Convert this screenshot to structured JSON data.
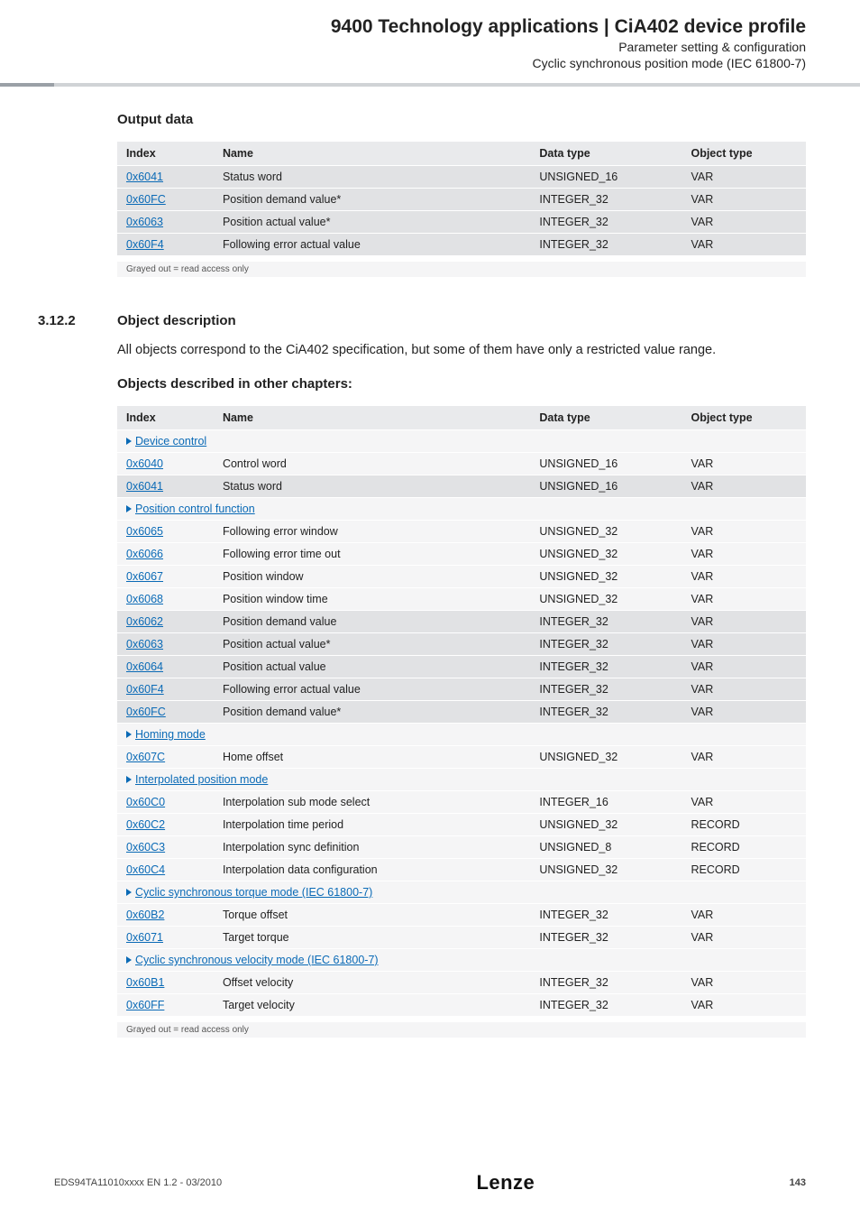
{
  "header": {
    "title": "9400 Technology applications | CiA402 device profile",
    "sub1": "Parameter setting & configuration",
    "sub2": "Cyclic synchronous position mode (IEC 61800-7)"
  },
  "output": {
    "heading": "Output data",
    "cols": [
      "Index",
      "Name",
      "Data type",
      "Object type"
    ],
    "rows": [
      {
        "idx": "0x6041",
        "name": "Status word",
        "dt": "UNSIGNED_16",
        "ot": "VAR",
        "shade": "dark"
      },
      {
        "idx": "0x60FC",
        "name": "Position demand value*",
        "dt": "INTEGER_32",
        "ot": "VAR",
        "shade": "dark"
      },
      {
        "idx": "0x6063",
        "name": "Position actual value*",
        "dt": "INTEGER_32",
        "ot": "VAR",
        "shade": "dark"
      },
      {
        "idx": "0x60F4",
        "name": "Following error actual value",
        "dt": "INTEGER_32",
        "ot": "VAR",
        "shade": "dark"
      }
    ],
    "footnote": "Grayed out = read access only"
  },
  "section": {
    "num": "3.12.2",
    "title": "Object description",
    "para": "All objects correspond to the CiA402 specification, but some of them have only a restricted value range."
  },
  "objects": {
    "heading": "Objects described in other chapters:",
    "cols": [
      "Index",
      "Name",
      "Data type",
      "Object type"
    ],
    "groups": [
      {
        "label": "Device control",
        "rows": [
          {
            "idx": "0x6040",
            "name": "Control word",
            "dt": "UNSIGNED_16",
            "ot": "VAR",
            "shade": "light"
          },
          {
            "idx": "0x6041",
            "name": "Status word",
            "dt": "UNSIGNED_16",
            "ot": "VAR",
            "shade": "dark"
          }
        ]
      },
      {
        "label": "Position control function",
        "rows": [
          {
            "idx": "0x6065",
            "name": "Following error window",
            "dt": "UNSIGNED_32",
            "ot": "VAR",
            "shade": "light"
          },
          {
            "idx": "0x6066",
            "name": "Following error time out",
            "dt": "UNSIGNED_32",
            "ot": "VAR",
            "shade": "light"
          },
          {
            "idx": "0x6067",
            "name": "Position window",
            "dt": "UNSIGNED_32",
            "ot": "VAR",
            "shade": "light"
          },
          {
            "idx": "0x6068",
            "name": "Position window time",
            "dt": "UNSIGNED_32",
            "ot": "VAR",
            "shade": "light"
          },
          {
            "idx": "0x6062",
            "name": "Position demand value",
            "dt": "INTEGER_32",
            "ot": "VAR",
            "shade": "dark"
          },
          {
            "idx": "0x6063",
            "name": "Position actual value*",
            "dt": "INTEGER_32",
            "ot": "VAR",
            "shade": "dark"
          },
          {
            "idx": "0x6064",
            "name": "Position actual value",
            "dt": "INTEGER_32",
            "ot": "VAR",
            "shade": "dark"
          },
          {
            "idx": "0x60F4",
            "name": "Following error actual value",
            "dt": "INTEGER_32",
            "ot": "VAR",
            "shade": "dark"
          },
          {
            "idx": "0x60FC",
            "name": "Position demand value*",
            "dt": "INTEGER_32",
            "ot": "VAR",
            "shade": "dark"
          }
        ]
      },
      {
        "label": "Homing mode",
        "rows": [
          {
            "idx": "0x607C",
            "name": "Home offset",
            "dt": "UNSIGNED_32",
            "ot": "VAR",
            "shade": "light"
          }
        ]
      },
      {
        "label": "Interpolated position mode",
        "rows": [
          {
            "idx": "0x60C0",
            "name": "Interpolation sub mode select",
            "dt": "INTEGER_16",
            "ot": "VAR",
            "shade": "light"
          },
          {
            "idx": "0x60C2",
            "name": "Interpolation time period",
            "dt": "UNSIGNED_32",
            "ot": "RECORD",
            "shade": "light"
          },
          {
            "idx": "0x60C3",
            "name": "Interpolation sync definition",
            "dt": "UNSIGNED_8",
            "ot": "RECORD",
            "shade": "light"
          },
          {
            "idx": "0x60C4",
            "name": "Interpolation data configuration",
            "dt": "UNSIGNED_32",
            "ot": "RECORD",
            "shade": "light"
          }
        ]
      },
      {
        "label": "Cyclic synchronous torque mode (IEC 61800-7)",
        "rows": [
          {
            "idx": "0x60B2",
            "name": "Torque offset",
            "dt": "INTEGER_32",
            "ot": "VAR",
            "shade": "light"
          },
          {
            "idx": "0x6071",
            "name": "Target torque",
            "dt": "INTEGER_32",
            "ot": "VAR",
            "shade": "light"
          }
        ]
      },
      {
        "label": "Cyclic synchronous velocity mode (IEC 61800-7)",
        "rows": [
          {
            "idx": "0x60B1",
            "name": "Offset velocity",
            "dt": "INTEGER_32",
            "ot": "VAR",
            "shade": "light"
          },
          {
            "idx": "0x60FF",
            "name": "Target velocity",
            "dt": "INTEGER_32",
            "ot": "VAR",
            "shade": "light"
          }
        ]
      }
    ],
    "footnote": "Grayed out = read access only"
  },
  "footer": {
    "left": "EDS94TA11010xxxx EN 1.2 - 03/2010",
    "logo": "Lenze",
    "page": "143"
  }
}
